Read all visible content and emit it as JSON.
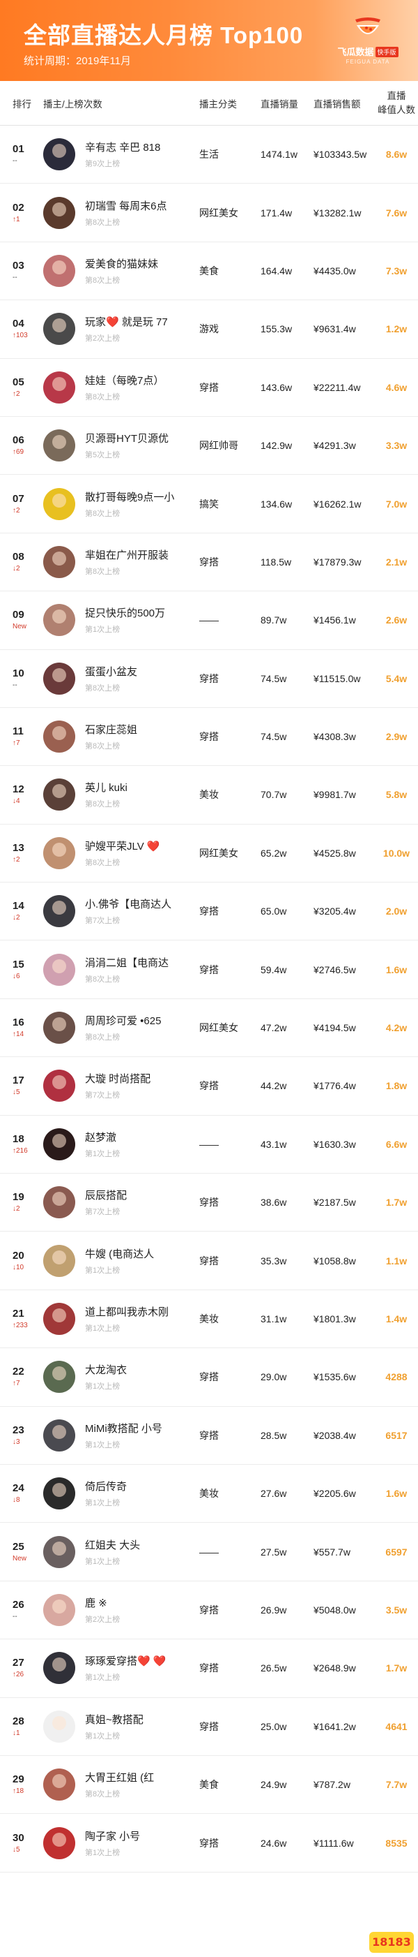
{
  "header": {
    "title": "全部直播达人月榜 Top100",
    "period": "统计周期：2019年11月",
    "brand_name": "飞瓜数据",
    "brand_tag": "快手版",
    "brand_sub": "FEIGUA DATA"
  },
  "columns": {
    "rank": "排行",
    "host": "播主/上榜次数",
    "category": "播主分类",
    "sales": "直播销量",
    "amount": "直播销售额",
    "peak_line1": "直播",
    "peak_line2": "峰值人数"
  },
  "rows": [
    {
      "rank": "01",
      "change": "--",
      "change_type": "same",
      "name": "辛有志 辛巴 818",
      "times": "第9次上榜",
      "category": "生活",
      "sales": "1474.1w",
      "amount": "¥103343.5w",
      "peak": "8.6w",
      "avatar_color": "#2b2b3a"
    },
    {
      "rank": "02",
      "change": "↑1",
      "change_type": "up",
      "name": "初瑞雪 每周末6点",
      "times": "第8次上榜",
      "category": "网红美女",
      "sales": "171.4w",
      "amount": "¥13282.1w",
      "peak": "7.6w",
      "avatar_color": "#5a3a2c"
    },
    {
      "rank": "03",
      "change": "--",
      "change_type": "same",
      "name": "爱美食的猫妹妹",
      "times": "第8次上榜",
      "category": "美食",
      "sales": "164.4w",
      "amount": "¥4435.0w",
      "peak": "7.3w",
      "avatar_color": "#c07070"
    },
    {
      "rank": "04",
      "change": "↑103",
      "change_type": "up",
      "name": "玩家❤️ 就是玩 77",
      "times": "第2次上榜",
      "category": "游戏",
      "sales": "155.3w",
      "amount": "¥9631.4w",
      "peak": "1.2w",
      "avatar_color": "#4a4a4a"
    },
    {
      "rank": "05",
      "change": "↑2",
      "change_type": "up",
      "name": "娃娃（每晚7点）",
      "times": "第8次上榜",
      "category": "穿搭",
      "sales": "143.6w",
      "amount": "¥22211.4w",
      "peak": "4.6w",
      "avatar_color": "#b83848"
    },
    {
      "rank": "06",
      "change": "↑69",
      "change_type": "up",
      "name": "贝源哥HYT贝源优",
      "times": "第5次上榜",
      "category": "网红帅哥",
      "sales": "142.9w",
      "amount": "¥4291.3w",
      "peak": "3.3w",
      "avatar_color": "#7a6a5a"
    },
    {
      "rank": "07",
      "change": "↑2",
      "change_type": "up",
      "name": "散打哥每晚9点一小",
      "times": "第8次上榜",
      "category": "搞笑",
      "sales": "134.6w",
      "amount": "¥16262.1w",
      "peak": "7.0w",
      "avatar_color": "#e8c020"
    },
    {
      "rank": "08",
      "change": "↓2",
      "change_type": "up",
      "name": "芈姐在广州开服装",
      "times": "第8次上榜",
      "category": "穿搭",
      "sales": "118.5w",
      "amount": "¥17879.3w",
      "peak": "2.1w",
      "avatar_color": "#8a5a4a"
    },
    {
      "rank": "09",
      "change": "New",
      "change_type": "new",
      "name": "捉只快乐的500万",
      "times": "第1次上榜",
      "category": "——",
      "sales": "89.7w",
      "amount": "¥1456.1w",
      "peak": "2.6w",
      "avatar_color": "#b08070"
    },
    {
      "rank": "10",
      "change": "--",
      "change_type": "same",
      "name": "蛋蛋小盆友",
      "times": "第8次上榜",
      "category": "穿搭",
      "sales": "74.5w",
      "amount": "¥11515.0w",
      "peak": "5.4w",
      "avatar_color": "#6a3a3a"
    },
    {
      "rank": "11",
      "change": "↑7",
      "change_type": "up",
      "name": "石家庄蕊姐",
      "times": "第8次上榜",
      "category": "穿搭",
      "sales": "74.5w",
      "amount": "¥4308.3w",
      "peak": "2.9w",
      "avatar_color": "#9a6050"
    },
    {
      "rank": "12",
      "change": "↓4",
      "change_type": "up",
      "name": "英儿 kuki",
      "times": "第8次上榜",
      "category": "美妆",
      "sales": "70.7w",
      "amount": "¥9981.7w",
      "peak": "5.8w",
      "avatar_color": "#5a4038"
    },
    {
      "rank": "13",
      "change": "↑2",
      "change_type": "up",
      "name": "驴嫂平荣JLV ❤️",
      "times": "第8次上榜",
      "category": "网红美女",
      "sales": "65.2w",
      "amount": "¥4525.8w",
      "peak": "10.0w",
      "avatar_color": "#c09070"
    },
    {
      "rank": "14",
      "change": "↓2",
      "change_type": "up",
      "name": "小.佛爷【电商达人",
      "times": "第7次上榜",
      "category": "穿搭",
      "sales": "65.0w",
      "amount": "¥3205.4w",
      "peak": "2.0w",
      "avatar_color": "#3a3a40"
    },
    {
      "rank": "15",
      "change": "↓6",
      "change_type": "up",
      "name": "涓涓二姐【电商达",
      "times": "第8次上榜",
      "category": "穿搭",
      "sales": "59.4w",
      "amount": "¥2746.5w",
      "peak": "1.6w",
      "avatar_color": "#d0a0b0"
    },
    {
      "rank": "16",
      "change": "↑14",
      "change_type": "up",
      "name": "周周珍可爱 •625",
      "times": "第8次上榜",
      "category": "网红美女",
      "sales": "47.2w",
      "amount": "¥4194.5w",
      "peak": "4.2w",
      "avatar_color": "#6a5048"
    },
    {
      "rank": "17",
      "change": "↓5",
      "change_type": "up",
      "name": "大璇 时尚搭配",
      "times": "第7次上榜",
      "category": "穿搭",
      "sales": "44.2w",
      "amount": "¥1776.4w",
      "peak": "1.8w",
      "avatar_color": "#b03040"
    },
    {
      "rank": "18",
      "change": "↑216",
      "change_type": "up",
      "name": "赵梦澈",
      "times": "第1次上榜",
      "category": "——",
      "sales": "43.1w",
      "amount": "¥1630.3w",
      "peak": "6.6w",
      "avatar_color": "#2a1a1a"
    },
    {
      "rank": "19",
      "change": "↓2",
      "change_type": "up",
      "name": "辰辰搭配",
      "times": "第7次上榜",
      "category": "穿搭",
      "sales": "38.6w",
      "amount": "¥2187.5w",
      "peak": "1.7w",
      "avatar_color": "#8a5a50"
    },
    {
      "rank": "20",
      "change": "↓10",
      "change_type": "up",
      "name": "牛嫂 (电商达人",
      "times": "第1次上榜",
      "category": "穿搭",
      "sales": "35.3w",
      "amount": "¥1058.8w",
      "peak": "1.1w",
      "avatar_color": "#c0a070"
    },
    {
      "rank": "21",
      "change": "↑233",
      "change_type": "up",
      "name": "道上都叫我赤木刚",
      "times": "第1次上榜",
      "category": "美妆",
      "sales": "31.1w",
      "amount": "¥1801.3w",
      "peak": "1.4w",
      "avatar_color": "#a03838"
    },
    {
      "rank": "22",
      "change": "↑7",
      "change_type": "up",
      "name": "大龙淘衣",
      "times": "第1次上榜",
      "category": "穿搭",
      "sales": "29.0w",
      "amount": "¥1535.6w",
      "peak": "4288",
      "avatar_color": "#5a6a50"
    },
    {
      "rank": "23",
      "change": "↓3",
      "change_type": "up",
      "name": "MiMi教搭配 小号",
      "times": "第1次上榜",
      "category": "穿搭",
      "sales": "28.5w",
      "amount": "¥2038.4w",
      "peak": "6517",
      "avatar_color": "#4a4a50"
    },
    {
      "rank": "24",
      "change": "↓8",
      "change_type": "up",
      "name": "倚后传奇",
      "times": "第1次上榜",
      "category": "美妆",
      "sales": "27.6w",
      "amount": "¥2205.6w",
      "peak": "1.6w",
      "avatar_color": "#2a2a2a"
    },
    {
      "rank": "25",
      "change": "New",
      "change_type": "new",
      "name": "红姐夫 大头",
      "times": "第1次上榜",
      "category": "——",
      "sales": "27.5w",
      "amount": "¥557.7w",
      "peak": "6597",
      "avatar_color": "#6a6060"
    },
    {
      "rank": "26",
      "change": "--",
      "change_type": "same",
      "name": "鹿 ※",
      "times": "第2次上榜",
      "category": "穿搭",
      "sales": "26.9w",
      "amount": "¥5048.0w",
      "peak": "3.5w",
      "avatar_color": "#d8a8a0"
    },
    {
      "rank": "27",
      "change": "↑26",
      "change_type": "up",
      "name": "琢琢爱穿搭❤️ ❤️",
      "times": "第1次上榜",
      "category": "穿搭",
      "sales": "26.5w",
      "amount": "¥2648.9w",
      "peak": "1.7w",
      "avatar_color": "#303038"
    },
    {
      "rank": "28",
      "change": "↓1",
      "change_type": "up",
      "name": "真姐~教搭配",
      "times": "第1次上榜",
      "category": "穿搭",
      "sales": "25.0w",
      "amount": "¥1641.2w",
      "peak": "4641",
      "avatar_color": "#f0f0f0"
    },
    {
      "rank": "29",
      "change": "↑18",
      "change_type": "up",
      "name": "大胃王红姐 (红",
      "times": "第8次上榜",
      "category": "美食",
      "sales": "24.9w",
      "amount": "¥787.2w",
      "peak": "7.7w",
      "avatar_color": "#b06050"
    },
    {
      "rank": "30",
      "change": "↓5",
      "change_type": "up",
      "name": "陶子家 小号",
      "times": "第1次上榜",
      "category": "穿搭",
      "sales": "24.6w",
      "amount": "¥1111.6w",
      "peak": "8535",
      "avatar_color": "#c03030"
    }
  ],
  "watermark": "18183"
}
